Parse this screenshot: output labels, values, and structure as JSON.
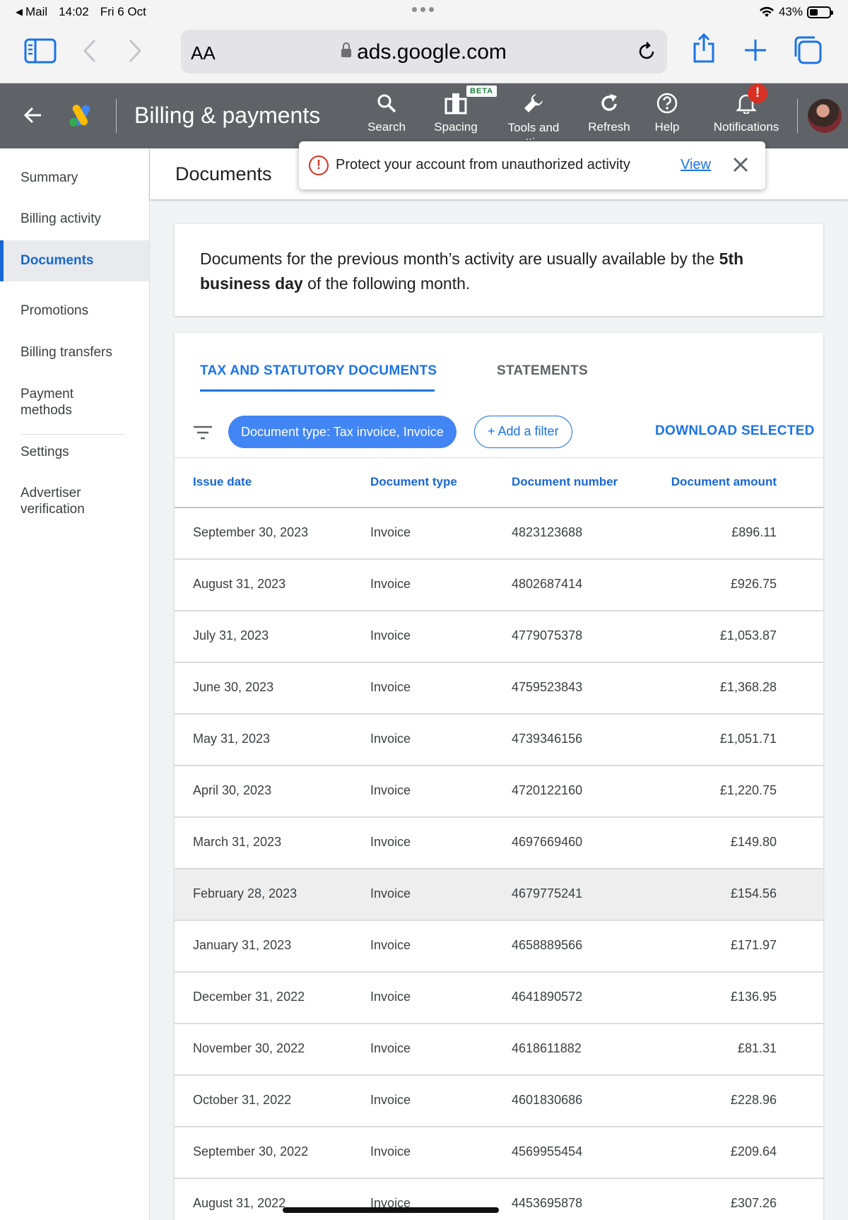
{
  "status_bar": {
    "app": "Mail",
    "time": "14:02",
    "date": "Fri 6 Oct",
    "battery": "43%",
    "battery_level": 0.43
  },
  "browser": {
    "text_size_label": "AA",
    "url": "ads.google.com"
  },
  "header": {
    "title": "Billing & payments",
    "tools": [
      {
        "label": "Search",
        "icon": "search-icon"
      },
      {
        "label": "Spacing",
        "icon": "spacing-icon",
        "badge": "BETA"
      },
      {
        "label": "Tools and settings",
        "icon": "wrench-icon"
      },
      {
        "label": "Refresh",
        "icon": "refresh-icon"
      },
      {
        "label": "Help",
        "icon": "help-icon"
      },
      {
        "label": "Notifications",
        "icon": "bell-icon",
        "badge": "!"
      }
    ]
  },
  "sidebar": {
    "items": [
      {
        "label": "Summary"
      },
      {
        "label": "Billing activity"
      },
      {
        "label": "Documents",
        "active": true
      },
      {
        "label": "Promotions"
      },
      {
        "label": "Billing transfers"
      },
      {
        "label": "Payment methods"
      },
      {
        "label": "Settings"
      },
      {
        "label": "Advertiser verification"
      }
    ]
  },
  "page": {
    "title": "Documents",
    "toast": {
      "message": "Protect your account from unauthorized activity",
      "link": "View"
    },
    "info": {
      "part1": "Documents for the previous month’s activity are usually available by the ",
      "bold": "5th business day",
      "part2": " of the following month."
    },
    "tabs": [
      {
        "label": "TAX AND STATUTORY DOCUMENTS",
        "active": true
      },
      {
        "label": "STATEMENTS",
        "active": false
      }
    ],
    "filter_chip": "Document type: Tax invoice, Invoice",
    "add_filter": "+ Add a filter",
    "download_selected": "DOWNLOAD SELECTED",
    "table": {
      "columns": [
        "Issue date",
        "Document type",
        "Document number",
        "Document amount"
      ],
      "rows": [
        [
          "September 30, 2023",
          "Invoice",
          "4823123688",
          "£896.11"
        ],
        [
          "August 31, 2023",
          "Invoice",
          "4802687414",
          "£926.75"
        ],
        [
          "July 31, 2023",
          "Invoice",
          "4779075378",
          "£1,053.87"
        ],
        [
          "June 30, 2023",
          "Invoice",
          "4759523843",
          "£1,368.28"
        ],
        [
          "May 31, 2023",
          "Invoice",
          "4739346156",
          "£1,051.71"
        ],
        [
          "April 30, 2023",
          "Invoice",
          "4720122160",
          "£1,220.75"
        ],
        [
          "March 31, 2023",
          "Invoice",
          "4697669460",
          "£149.80"
        ],
        [
          "February 28, 2023",
          "Invoice",
          "4679775241",
          "£154.56"
        ],
        [
          "January 31, 2023",
          "Invoice",
          "4658889566",
          "£171.97"
        ],
        [
          "December 31, 2022",
          "Invoice",
          "4641890572",
          "£136.95"
        ],
        [
          "November 30, 2022",
          "Invoice",
          "4618611882",
          "£81.31"
        ],
        [
          "October 31, 2022",
          "Invoice",
          "4601830686",
          "£228.96"
        ],
        [
          "September 30, 2022",
          "Invoice",
          "4569955454",
          "£209.64"
        ],
        [
          "August 31, 2022",
          "Invoice",
          "4453695878",
          "£307.26"
        ]
      ],
      "highlighted_row": 7
    }
  },
  "colors": {
    "accent": "#1a73e8",
    "header_bg": "#5f6368",
    "chip_bg": "#4285f4",
    "alert": "#d93025"
  }
}
